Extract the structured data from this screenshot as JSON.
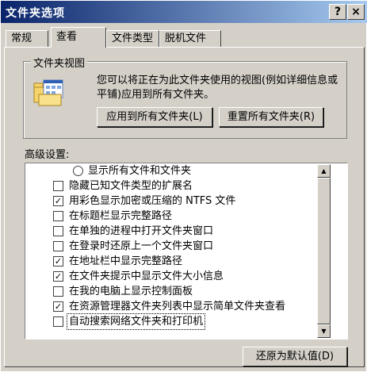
{
  "window": {
    "title": "文件夹选项",
    "help_glyph": "?",
    "close_glyph": "×"
  },
  "tabs": [
    {
      "label": "常规"
    },
    {
      "label": "查看"
    },
    {
      "label": "文件类型"
    },
    {
      "label": "脱机文件"
    }
  ],
  "active_tab": "查看",
  "folder_views": {
    "legend": "文件夹视图",
    "description": "您可以将正在为此文件夹使用的视图(例如详细信息或平铺)应用到所有文件夹。",
    "apply_button": "应用到所有文件夹(L)",
    "reset_button": "重置所有文件夹(R)",
    "icon": "folder-views-icon"
  },
  "advanced": {
    "label": "高级设置:",
    "items": [
      {
        "type": "radio",
        "checked": false,
        "label": "显示所有文件和文件夹"
      },
      {
        "type": "checkbox",
        "checked": false,
        "label": "隐藏已知文件类型的扩展名"
      },
      {
        "type": "checkbox",
        "checked": true,
        "label": "用彩色显示加密或压缩的 NTFS 文件"
      },
      {
        "type": "checkbox",
        "checked": false,
        "label": "在标题栏显示完整路径"
      },
      {
        "type": "checkbox",
        "checked": false,
        "label": "在单独的进程中打开文件夹窗口"
      },
      {
        "type": "checkbox",
        "checked": false,
        "label": "在登录时还原上一个文件夹窗口"
      },
      {
        "type": "checkbox",
        "checked": true,
        "label": "在地址栏中显示完整路径"
      },
      {
        "type": "checkbox",
        "checked": true,
        "label": "在文件夹提示中显示文件大小信息"
      },
      {
        "type": "checkbox",
        "checked": false,
        "label": "在我的电脑上显示控制面板"
      },
      {
        "type": "checkbox",
        "checked": true,
        "label": "在资源管理器文件夹列表中显示简单文件夹查看"
      },
      {
        "type": "checkbox",
        "checked": false,
        "label": "自动搜索网络文件夹和打印机",
        "selected": true
      }
    ]
  },
  "restore_button": "还原为默认值(D)",
  "scrollbar": {
    "up_glyph": "▲",
    "down_glyph": "▼"
  },
  "colors": {
    "titlebar_start": "#0a246a",
    "titlebar_end": "#a6caf0",
    "face": "#d4d0c8"
  }
}
